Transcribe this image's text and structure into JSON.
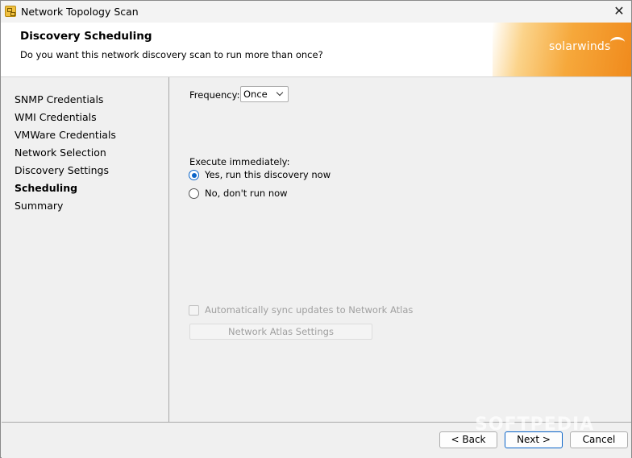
{
  "window": {
    "title": "Network Topology Scan",
    "close_glyph": "✕"
  },
  "header": {
    "title": "Discovery Scheduling",
    "subtitle": "Do you want this network discovery scan to run more than once?",
    "brand": "solarwinds"
  },
  "sidebar": {
    "items": [
      {
        "label": "SNMP Credentials",
        "active": false
      },
      {
        "label": "WMI Credentials",
        "active": false
      },
      {
        "label": "VMWare Credentials",
        "active": false
      },
      {
        "label": "Network Selection",
        "active": false
      },
      {
        "label": "Discovery Settings",
        "active": false
      },
      {
        "label": "Scheduling",
        "active": true
      },
      {
        "label": "Summary",
        "active": false
      }
    ]
  },
  "content": {
    "frequency_label": "Frequency:",
    "frequency_value": "Once",
    "execute_label": "Execute immediately:",
    "radio_yes_label": "Yes, run this discovery now",
    "radio_no_label": "No, don't run now",
    "selected_option": "yes",
    "sync_label": "Automatically sync updates to Network Atlas",
    "sync_checked": false,
    "atlas_settings_label": "Network Atlas Settings"
  },
  "footer": {
    "back_label": "< Back",
    "next_label": "Next >",
    "cancel_label": "Cancel"
  },
  "watermark": "SOFTPEDIA",
  "colors": {
    "accent": "#0a64c8",
    "brand_orange": "#f08a1c"
  }
}
